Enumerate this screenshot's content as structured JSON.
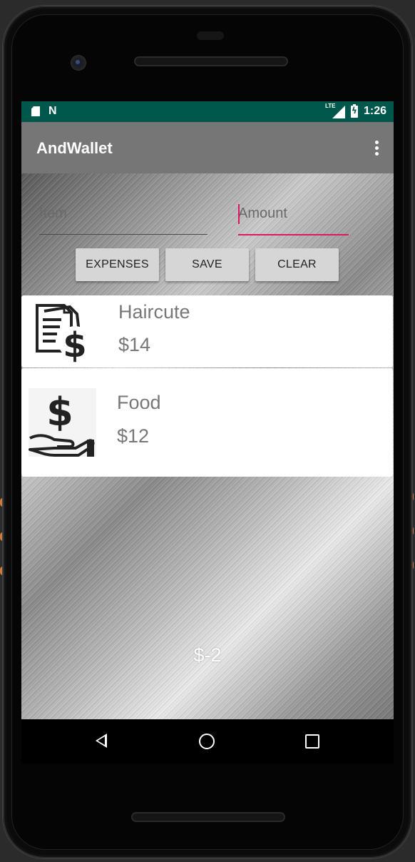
{
  "statusbar": {
    "network_label": "LTE",
    "time": "1:26"
  },
  "appbar": {
    "title": "AndWallet",
    "overflow_icon": "more-vert-icon"
  },
  "form": {
    "item_placeholder": "Item",
    "item_value": "",
    "amount_placeholder": "Amount",
    "amount_value": "",
    "accent_color": "#d81b60"
  },
  "buttons": {
    "expenses_label": "EXPENSES",
    "save_label": "SAVE",
    "clear_label": "CLEAR"
  },
  "entries": [
    {
      "name": "Haircute",
      "amount": "$14",
      "icon": "bill-document-dollar-icon"
    },
    {
      "name": "Food",
      "amount": "$12",
      "icon": "hand-dollar-icon"
    }
  ],
  "total": "$-2",
  "colors": {
    "statusbar": "#00574b",
    "appbar": "#767676"
  },
  "navbar": {
    "back_icon": "back-icon",
    "home_icon": "home-icon",
    "recents_icon": "recents-icon"
  }
}
